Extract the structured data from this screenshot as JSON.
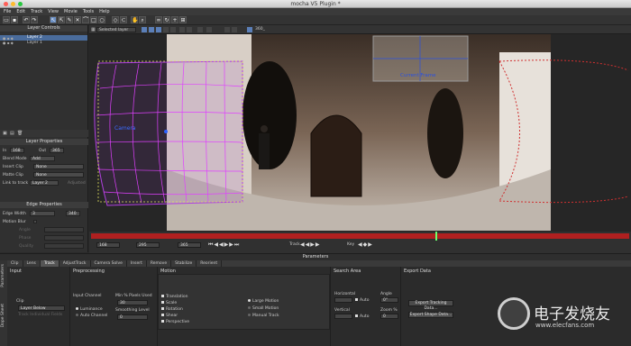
{
  "window": {
    "title": "mocha V5 Plugin *"
  },
  "menu": [
    "File",
    "Edit",
    "Track",
    "View",
    "Movie",
    "Tools",
    "Help"
  ],
  "toolbar": {
    "layer_select": "Selected layer",
    "zoom_value": "360_"
  },
  "layer_controls": {
    "header": "Layer Controls",
    "layers": [
      {
        "name": "Layer 2",
        "selected": true
      },
      {
        "name": "Layer 1",
        "selected": false
      }
    ]
  },
  "layer_properties": {
    "header": "Layer Properties",
    "in_label": "In",
    "in_value": "168",
    "out_label": "Out",
    "out_value": "365",
    "blend_mode_label": "Blend Mode",
    "blend_mode_value": "Add",
    "insert_clip_label": "Insert Clip",
    "insert_clip_value": "None",
    "matte_clip_label": "Matte Clip",
    "matte_clip_value": "None",
    "link_to_track_label": "Link to track",
    "link_to_track_value": "Layer 2",
    "adjusted_label": "Adjusted"
  },
  "edge_properties": {
    "header": "Edge Properties",
    "edge_width_label": "Edge Width",
    "edge_width_value": "3",
    "edge_width_extra": "340",
    "motion_blur_label": "Motion Blur",
    "angle_label": "Angle",
    "phase_label": "Phase",
    "quality_label": "Quality"
  },
  "viewer": {
    "camera_label": "Camera",
    "current_frame_label": "Current Frame"
  },
  "timeline": {
    "start": "168",
    "current": "295",
    "end": "365",
    "track_label": "Track",
    "key_label": "Key"
  },
  "parameters": {
    "header": "Parameters",
    "tabs": [
      "Clip",
      "Lens",
      "Track",
      "AdjustTrack",
      "Camera Solve",
      "Insert",
      "Remove",
      "Stabilize",
      "Reorient"
    ],
    "active_tab": "Track",
    "side_tabs": [
      "Parameters",
      "Dope Sheet"
    ],
    "input": {
      "header": "Input",
      "clip_label": "Clip",
      "clip_value": "Layer Below",
      "track_label": "Track Individual Fields"
    },
    "preprocessing": {
      "header": "Preprocessing",
      "input_channel_label": "Input Channel",
      "luminance": "Luminance",
      "auto_channel": "Auto Channel",
      "min_pixels_label": "Min % Pixels Used",
      "min_pixels_value": "30",
      "smoothing_label": "Smoothing Level",
      "smoothing_value": "0"
    },
    "motion": {
      "header": "Motion",
      "options": [
        "Translation",
        "Scale",
        "Rotation",
        "Shear",
        "Perspective"
      ],
      "large_motion": "Large Motion",
      "small_motion": "Small Motion",
      "manual_track": "Manual Track"
    },
    "search_area": {
      "header": "Search Area",
      "horizontal_label": "Horizontal",
      "vertical_label": "Vertical",
      "auto_label": "Auto",
      "angle_label": "Angle",
      "angle_value": "0°",
      "zoom_label": "Zoom %",
      "zoom_value": "0"
    },
    "export_data": {
      "header": "Export Data",
      "tracking_button": "Export Tracking Data...",
      "shape_button": "Export Shape Data..."
    }
  },
  "watermark": {
    "text": "电子发烧友",
    "url": "www.elecfans.com"
  }
}
